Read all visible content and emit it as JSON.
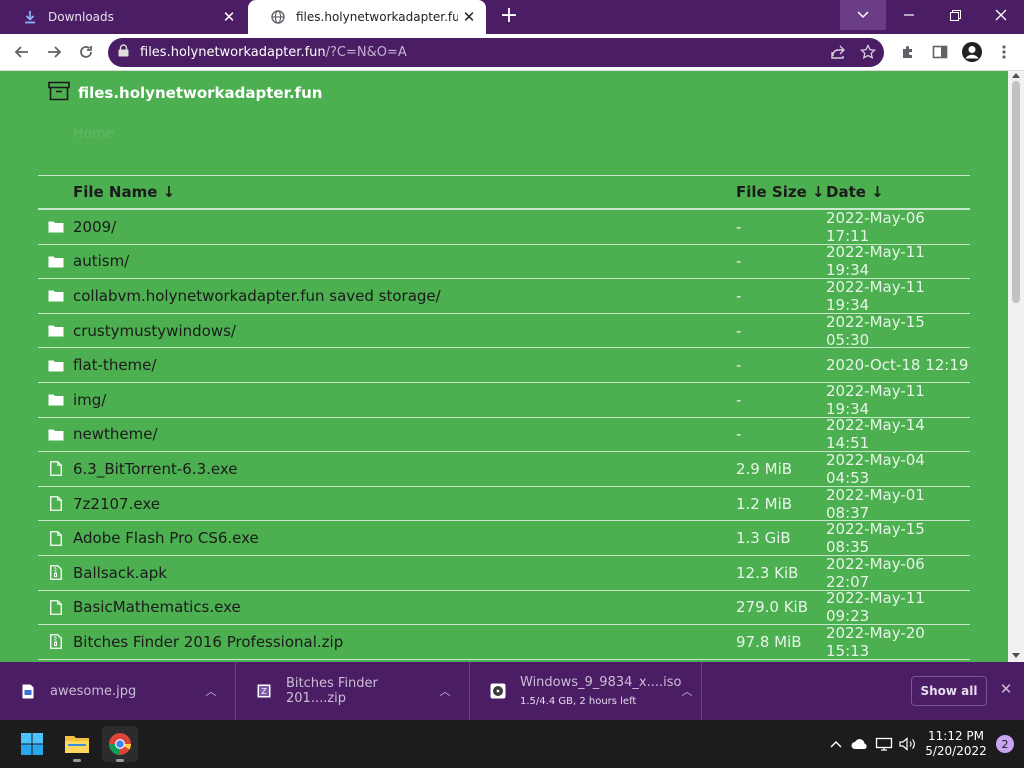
{
  "browser": {
    "tabs": [
      {
        "title": "Downloads",
        "icon": "download-icon",
        "active": false
      },
      {
        "title": "files.holynetworkadapter.fun",
        "icon": "globe-icon",
        "active": true
      }
    ],
    "address": {
      "host": "files.holynetworkadapter.fun",
      "path": "/?C=N&O=A"
    },
    "accent_color": "#4a1d64"
  },
  "page": {
    "site_title": "files.holynetworkadapter.fun",
    "breadcrumb": "Home",
    "background_color": "#4caf50",
    "columns": {
      "name": "File Name  ↓",
      "size": "File Size  ↓",
      "date": "Date  ↓"
    },
    "rows": [
      {
        "type": "folder",
        "name": "2009/",
        "size": "-",
        "date": "2022-May-06 17:11"
      },
      {
        "type": "folder",
        "name": "autism/",
        "size": "-",
        "date": "2022-May-11 19:34"
      },
      {
        "type": "folder",
        "name": "collabvm.holynetworkadapter.fun saved storage/",
        "size": "-",
        "date": "2022-May-11 19:34"
      },
      {
        "type": "folder",
        "name": "crustymustywindows/",
        "size": "-",
        "date": "2022-May-15 05:30"
      },
      {
        "type": "folder",
        "name": "flat-theme/",
        "size": "-",
        "date": "2020-Oct-18 12:19"
      },
      {
        "type": "folder",
        "name": "img/",
        "size": "-",
        "date": "2022-May-11 19:34"
      },
      {
        "type": "folder",
        "name": "newtheme/",
        "size": "-",
        "date": "2022-May-14 14:51"
      },
      {
        "type": "file",
        "name": "6.3_BitTorrent-6.3.exe",
        "size": "2.9 MiB",
        "date": "2022-May-04 04:53"
      },
      {
        "type": "file",
        "name": "7z2107.exe",
        "size": "1.2 MiB",
        "date": "2022-May-01 08:37"
      },
      {
        "type": "file",
        "name": "Adobe Flash Pro CS6.exe",
        "size": "1.3 GiB",
        "date": "2022-May-15 08:35"
      },
      {
        "type": "archive",
        "name": "Ballsack.apk",
        "size": "12.3 KiB",
        "date": "2022-May-06 22:07"
      },
      {
        "type": "file",
        "name": "BasicMathematics.exe",
        "size": "279.0 KiB",
        "date": "2022-May-11 09:23"
      },
      {
        "type": "archive",
        "name": "Bitches Finder 2016 Professional.zip",
        "size": "97.8 MiB",
        "date": "2022-May-20 15:13"
      }
    ]
  },
  "downloads": {
    "items": [
      {
        "name": "awesome.jpg",
        "status": "",
        "icon": "image-file-icon"
      },
      {
        "name": "Bitches Finder 201....zip",
        "status": "",
        "icon": "zip-file-icon"
      },
      {
        "name": "Windows_9_9834_x....iso",
        "status": "1.5/4.4 GB, 2 hours left",
        "icon": "iso-file-icon"
      }
    ],
    "show_all_label": "Show all"
  },
  "taskbar": {
    "time": "11:12 PM",
    "date": "5/20/2022",
    "notification_count": "2"
  }
}
